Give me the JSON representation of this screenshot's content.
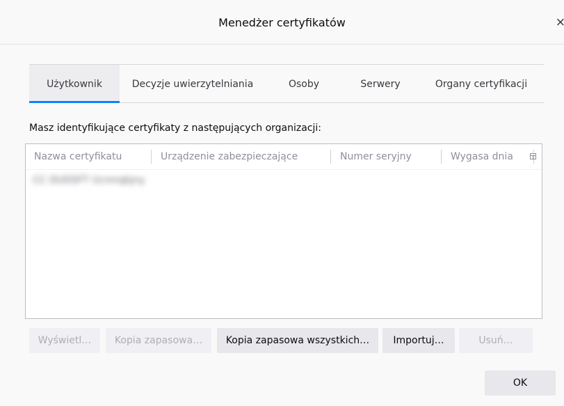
{
  "window": {
    "title": "Menedżer certyfikatów",
    "close_label": "×"
  },
  "tabs": [
    {
      "label": "Użytkownik",
      "selected": true
    },
    {
      "label": "Decyzje uwierzytelniania",
      "selected": false
    },
    {
      "label": "Osoby",
      "selected": false
    },
    {
      "label": "Serwery",
      "selected": false
    },
    {
      "label": "Organy certyfikacji",
      "selected": false
    }
  ],
  "description": "Masz identyfikujące certyfikaty z następujących organizacji:",
  "table": {
    "columns": [
      "Nazwa certyfikatu",
      "Urządzenie zabezpieczające",
      "Numer seryjny",
      "Wygasa dnia"
    ],
    "rows": [
      {
        "name": "CC DUDSFT Ucmrqbjny"
      }
    ]
  },
  "buttons": {
    "view": "Wyświetl…",
    "backup": "Kopia zapasowa…",
    "backup_all": "Kopia zapasowa wszystkich…",
    "import": "Importuj…",
    "delete": "Usuń…",
    "ok": "OK"
  },
  "colors": {
    "accent": "#0a84ff"
  }
}
